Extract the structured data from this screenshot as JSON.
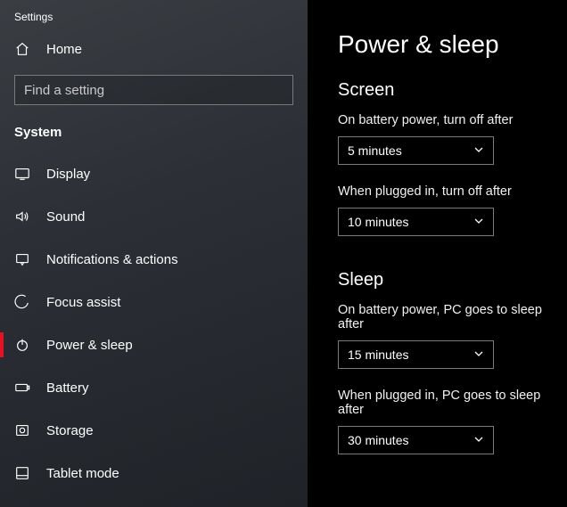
{
  "app_title": "Settings",
  "home_label": "Home",
  "search": {
    "placeholder": "Find a setting"
  },
  "category": "System",
  "nav": [
    {
      "label": "Display"
    },
    {
      "label": "Sound"
    },
    {
      "label": "Notifications & actions"
    },
    {
      "label": "Focus assist"
    },
    {
      "label": "Power & sleep"
    },
    {
      "label": "Battery"
    },
    {
      "label": "Storage"
    },
    {
      "label": "Tablet mode"
    }
  ],
  "page": {
    "title": "Power & sleep",
    "sections": [
      {
        "heading": "Screen",
        "fields": [
          {
            "label": "On battery power, turn off after",
            "value": "5 minutes"
          },
          {
            "label": "When plugged in, turn off after",
            "value": "10 minutes"
          }
        ]
      },
      {
        "heading": "Sleep",
        "fields": [
          {
            "label": "On battery power, PC goes to sleep after",
            "value": "15 minutes"
          },
          {
            "label": "When plugged in, PC goes to sleep after",
            "value": "30 minutes"
          }
        ]
      }
    ]
  }
}
